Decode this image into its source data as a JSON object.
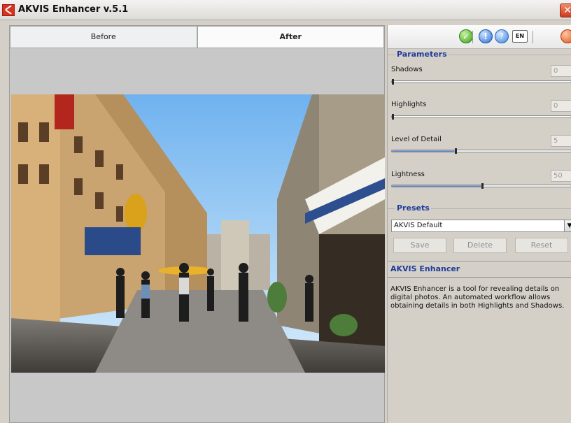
{
  "window": {
    "title": "AKVIS Enhancer v.5.1",
    "close_glyph": "✕"
  },
  "tabs": [
    {
      "label": "Before",
      "active": false
    },
    {
      "label": "After",
      "active": true
    }
  ],
  "toolbar": {
    "ok_icon": "check-icon",
    "ok_glyph": "✓",
    "info_icon": "info-icon",
    "info_glyph": "!",
    "help_icon": "help-icon",
    "help_glyph": "?",
    "lang_label": "EN",
    "exit_icon": "exit-icon"
  },
  "parameters": {
    "title": "Parameters",
    "items": [
      {
        "label": "Shadows",
        "value": "0",
        "fraction": 0.0
      },
      {
        "label": "Highlights",
        "value": "0",
        "fraction": 0.0
      },
      {
        "label": "Level of Detail",
        "value": "5",
        "fraction": 0.35
      },
      {
        "label": "Lightness",
        "value": "50",
        "fraction": 0.5
      }
    ]
  },
  "presets": {
    "title": "Presets",
    "selected": "AKVIS Default",
    "save_label": "Save",
    "delete_label": "Delete",
    "reset_label": "Reset"
  },
  "info": {
    "title": "AKVIS Enhancer",
    "text": "AKVIS Enhancer is a tool for revealing details on digital photos. An automated workflow allows obtaining details in both Highlights and Shadows."
  },
  "colors": {
    "accent_blue": "#1f3b9c",
    "panel_bg": "#d4d0c8",
    "close_red": "#d0391c"
  }
}
